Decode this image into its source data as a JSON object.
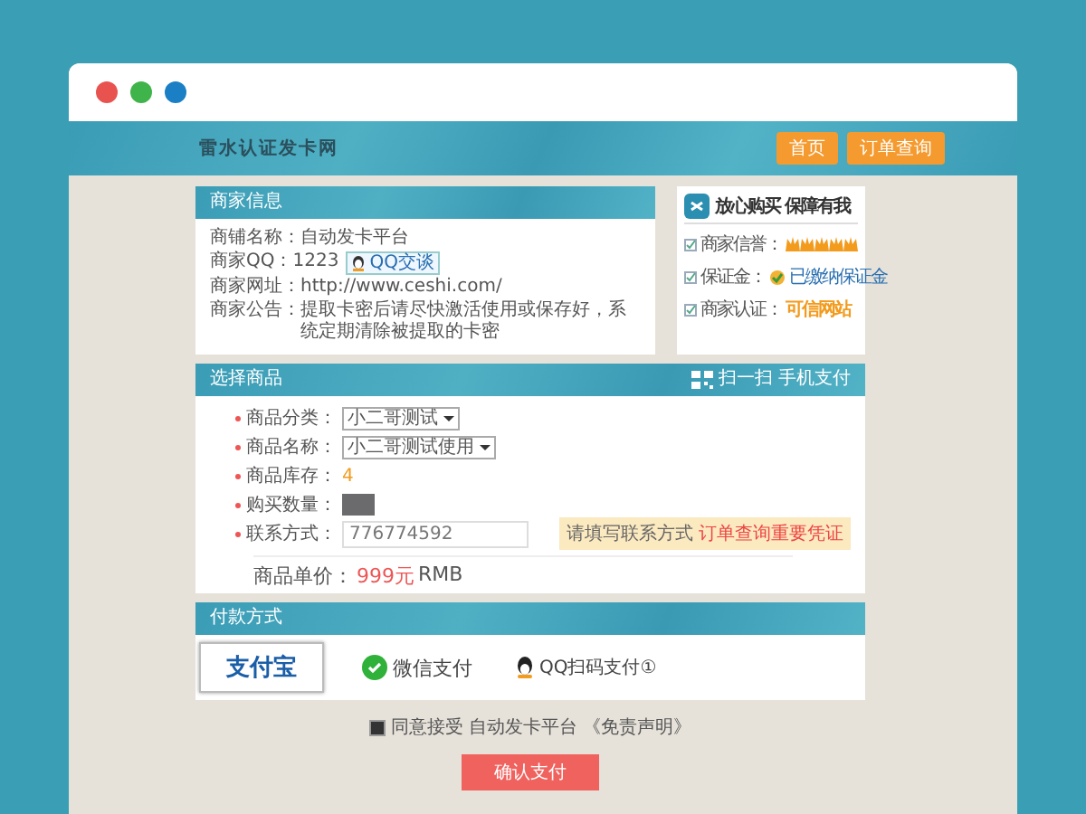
{
  "window": {
    "dots": [
      {
        "color": "#e8534f"
      },
      {
        "color": "#3fb44a"
      },
      {
        "color": "#1a7fc4"
      }
    ]
  },
  "header": {
    "logo": "雷水认证发卡网",
    "nav": [
      {
        "label": "首页"
      },
      {
        "label": "订单查询"
      }
    ]
  },
  "merchant": {
    "title": "商家信息",
    "rows": [
      {
        "label": "商铺名称：",
        "value": "自动发卡平台"
      },
      {
        "label": "商家QQ：",
        "value": "1223",
        "kind": "qq",
        "action": "QQ交谈"
      },
      {
        "label": "商家网址：",
        "value": "http://www.ceshi.com/"
      },
      {
        "label": "商家公告：",
        "value": "提取卡密后请尽快激活使用或保存好，系统定期清除被提取的卡密"
      }
    ]
  },
  "trust": {
    "title": "放心购买  保障有我",
    "reputation": {
      "label": "商家信誉：",
      "stars": 5
    },
    "deposit": {
      "label": "保证金：",
      "value": "已缴纳保证金"
    },
    "certification": {
      "label": "商家认证：",
      "value": "可信网站"
    }
  },
  "order": {
    "title": "选择商品",
    "scan": "扫一扫 手机支付",
    "fields": [
      {
        "kind": "select",
        "label": "商品分类：",
        "value": "小二哥测试"
      },
      {
        "kind": "select",
        "label": "商品名称：",
        "value": "小二哥测试使用"
      },
      {
        "kind": "text",
        "label": "商品库存：",
        "value": "4"
      },
      {
        "kind": "dark",
        "label": "购买数量："
      },
      {
        "kind": "input",
        "label": "联系方式：",
        "value": "776774592",
        "hint": "请填写联系方式 ",
        "hint_highlight": "订单查询重要凭证"
      }
    ],
    "price_label": "商品单价：",
    "price": "999元",
    "currency": "RMB"
  },
  "payment": {
    "title": "付款方式",
    "methods": [
      {
        "kind": "alipay",
        "label": "支付宝",
        "selected": true
      },
      {
        "kind": "wechat",
        "label": "微信支付",
        "selected": false
      },
      {
        "kind": "qq",
        "label": "QQ扫码支付①",
        "selected": false
      }
    ]
  },
  "agreement": {
    "checked": true,
    "text": "同意接受 自动发卡平台",
    "link": "《免责声明》"
  },
  "submit": "确认支付"
}
